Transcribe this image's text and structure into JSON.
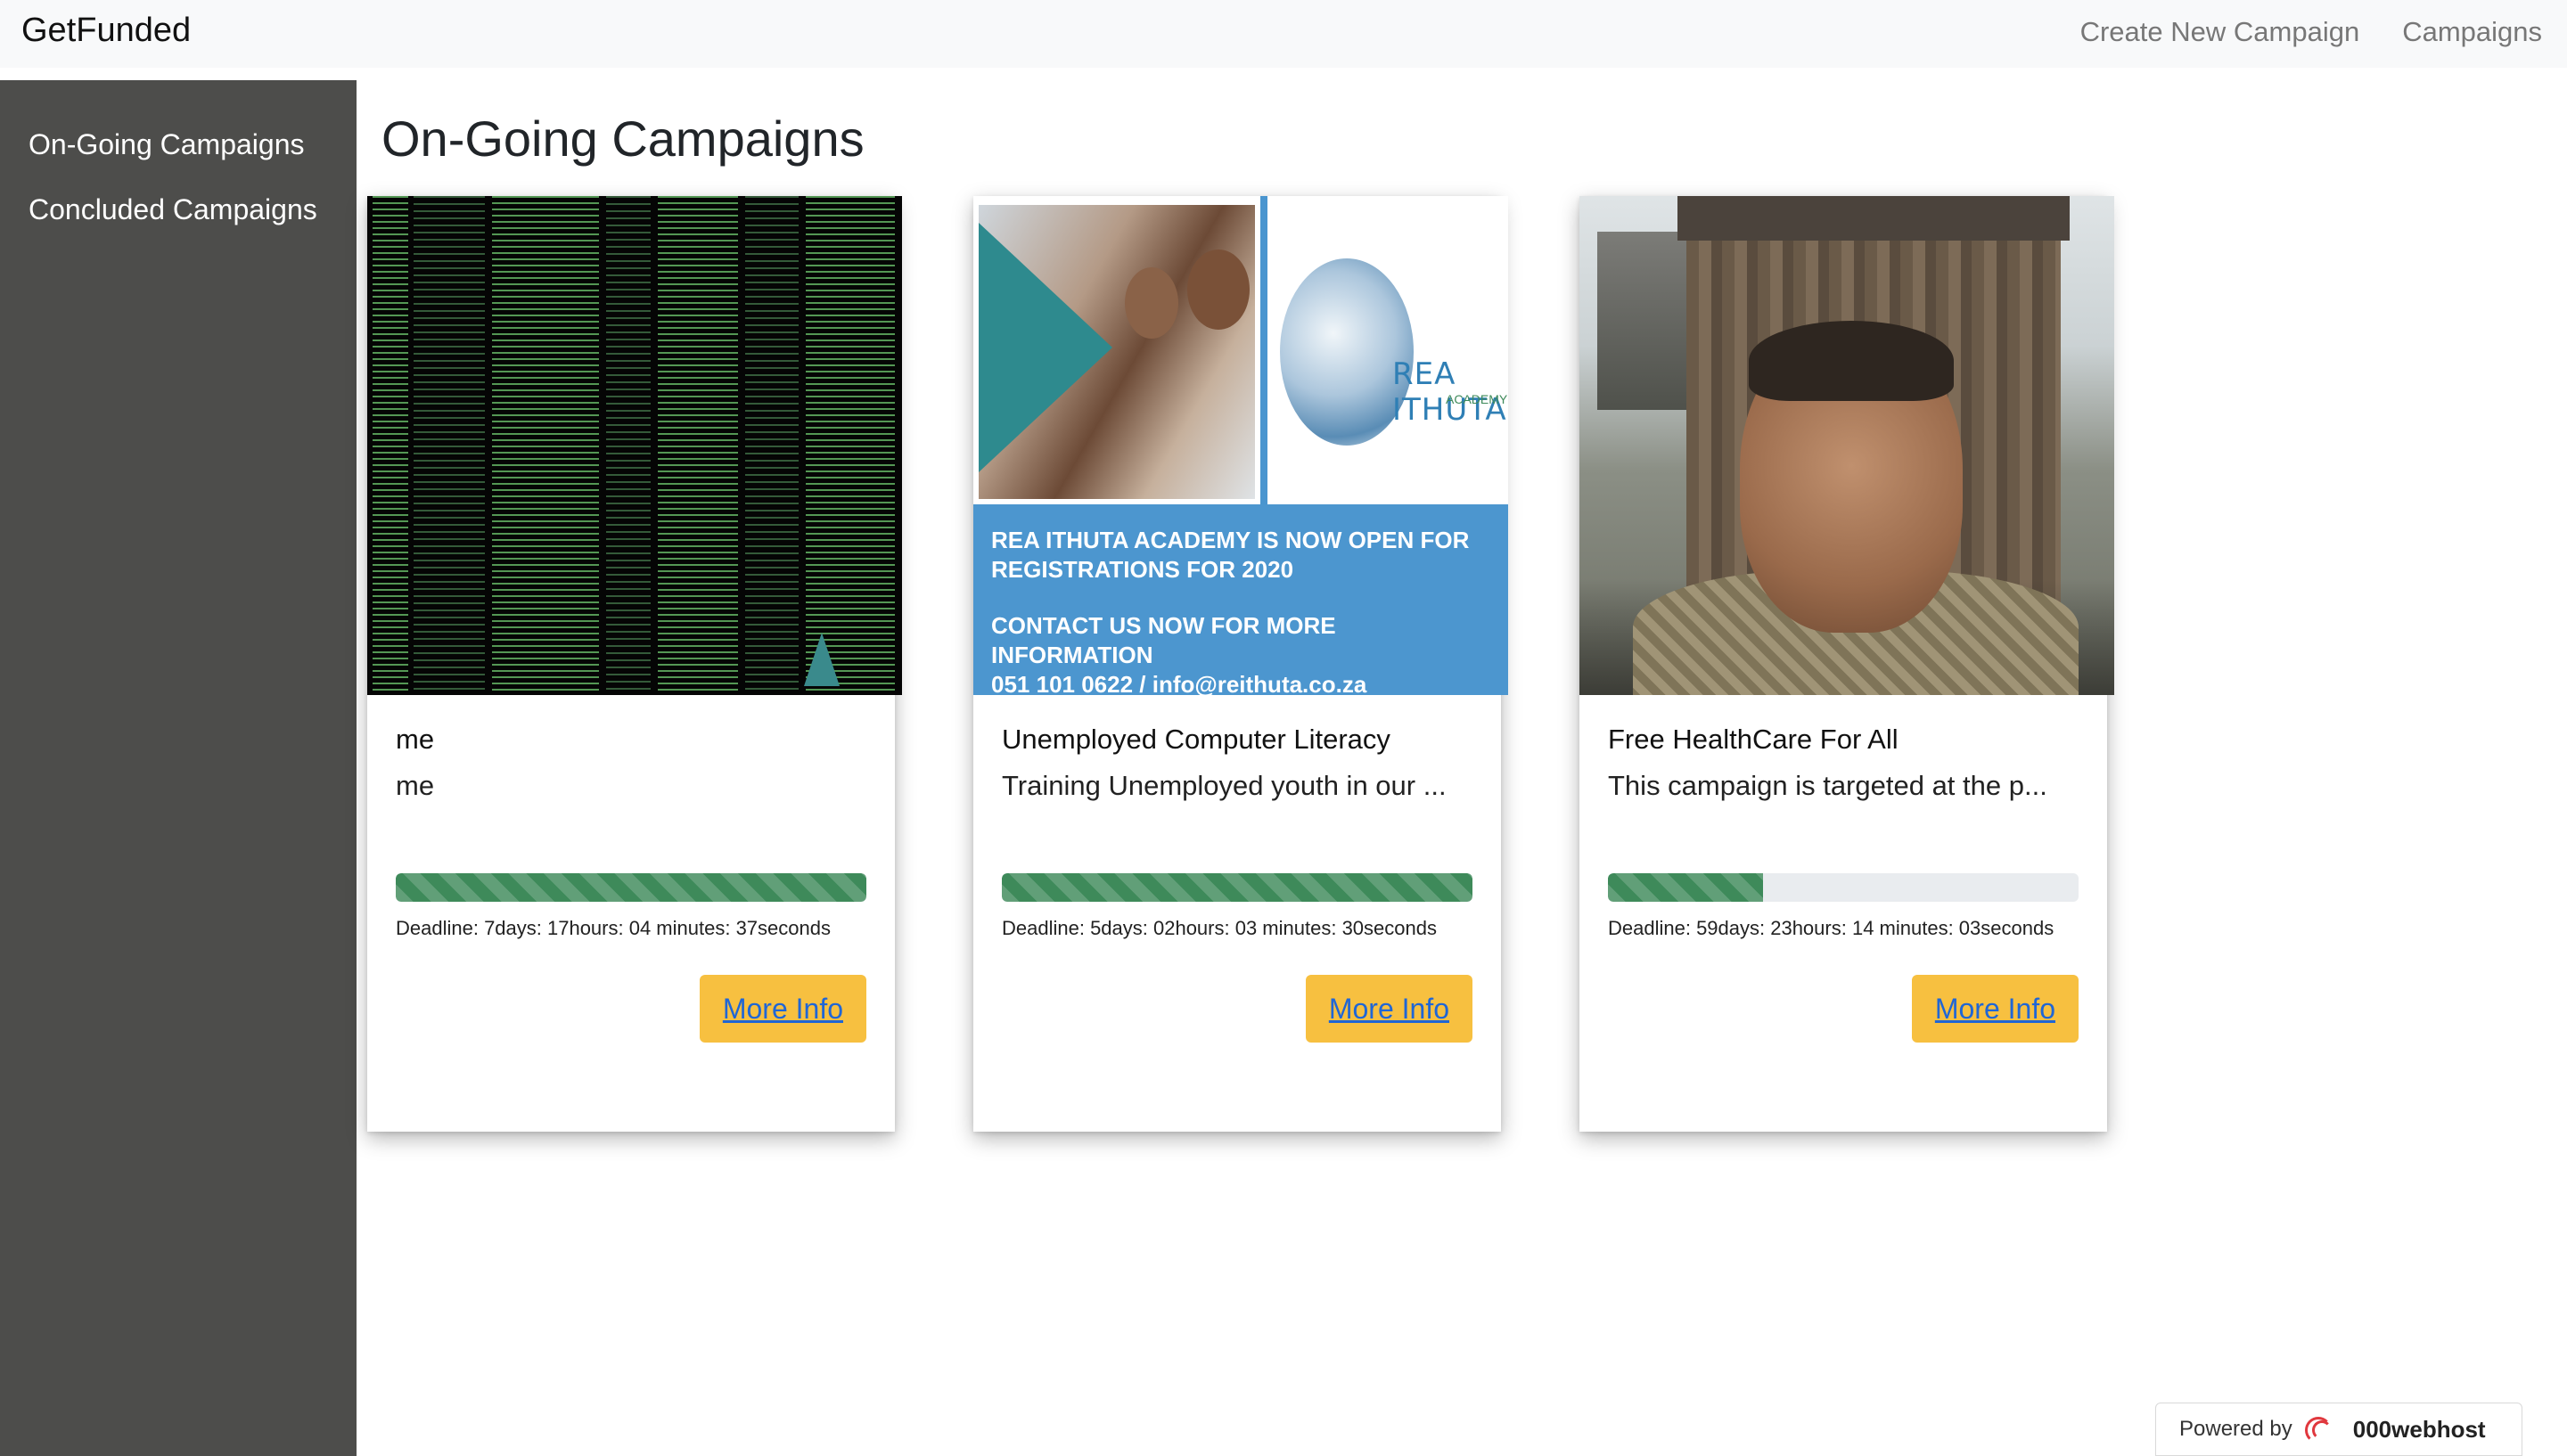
{
  "navbar": {
    "brand": "GetFunded",
    "links": [
      "Create New Campaign",
      "Campaigns"
    ]
  },
  "sidebar": {
    "items": [
      {
        "label": "On-Going Campaigns"
      },
      {
        "label": "Concluded Campaigns"
      }
    ]
  },
  "main": {
    "title": "On-Going Campaigns",
    "campaigns": [
      {
        "title": "me",
        "description": "me",
        "progress_percent": 100,
        "deadline": "Deadline: 7days: 17hours: 04 minutes: 37seconds",
        "button_label": "More Info",
        "image": "terminal-code-screenshot"
      },
      {
        "title": "Unemployed Computer Literacy",
        "description": "Training Unemployed youth in our ...",
        "progress_percent": 100,
        "deadline": "Deadline: 5days: 02hours: 03 minutes: 30seconds",
        "button_label": "More Info",
        "image": "rea-ithuta-academy-flyer",
        "image_text": {
          "logo": "REA ITHUTA",
          "logo_sub": "ACADEMY",
          "line1": "REA ITHUTA ACADEMY IS NOW OPEN FOR",
          "line2": "REGISTRATIONS FOR 2020",
          "line3": "CONTACT US NOW FOR MORE INFORMATION",
          "line4": "051 101 0622 / info@reithuta.co.za"
        }
      },
      {
        "title": "Free HealthCare For All",
        "description": "This campaign is targeted at the p...",
        "progress_percent": 33,
        "deadline": "Deadline: 59days: 23hours: 14 minutes: 03seconds",
        "button_label": "More Info",
        "image": "man-in-front-of-shack-photo"
      }
    ]
  },
  "footer_badge": {
    "prefix": "Powered by",
    "name": "000webhost"
  },
  "colors": {
    "navbar_bg": "#f8f9fa",
    "sidebar_bg": "#4d4d4b",
    "progress_fill": "#3e8a5a",
    "button_bg": "#f7c040",
    "button_text": "#1f66d6"
  }
}
